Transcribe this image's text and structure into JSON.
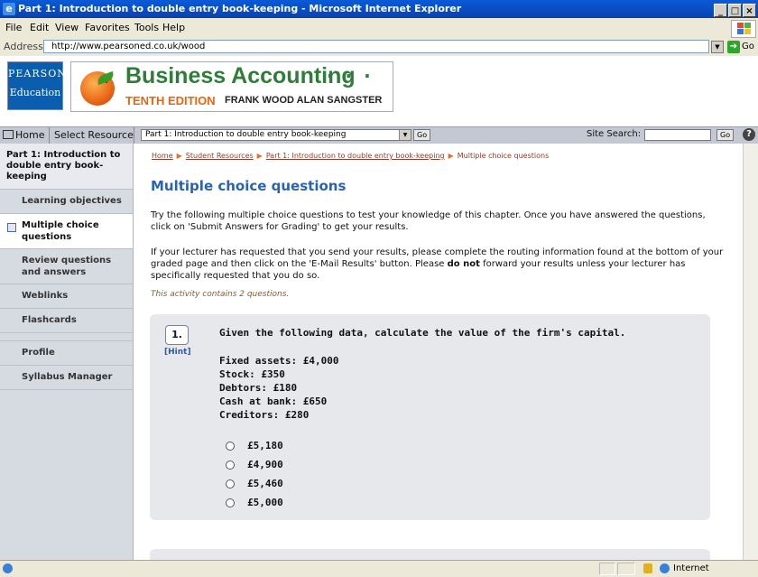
{
  "window": {
    "title": "Part 1: Introduction to double entry book-keeping - Microsoft Internet Explorer",
    "controls": [
      "_",
      "□",
      "×"
    ]
  },
  "menu": [
    "File",
    "Edit",
    "View",
    "Favorites",
    "Tools",
    "Help"
  ],
  "address": {
    "label": "Address",
    "url": "http://www.pearsoned.co.uk/wood",
    "go_label": "Go"
  },
  "banner": {
    "publisher_line1": "PEARSON",
    "publisher_line2": "Education",
    "book_title": "Business Accounting",
    "title_dots": "· · ·",
    "edition": "TENTH EDITION",
    "authors": "FRANK WOOD  ALAN SANGSTER"
  },
  "navbar": {
    "home": "Home",
    "select_resource": "Select Resource",
    "resource_value": "Part 1: Introduction to double entry book-keeping",
    "go": "Go",
    "site_search_label": "Site Search:",
    "help": "?"
  },
  "sidebar": {
    "title": "Part 1: Introduction to double entry book-keeping",
    "items": [
      {
        "label": "Learning objectives"
      },
      {
        "label": "Multiple choice questions"
      },
      {
        "label": "Review questions and answers"
      },
      {
        "label": "Weblinks"
      },
      {
        "label": "Flashcards"
      },
      {
        "label": "Profile"
      },
      {
        "label": "Syllabus Manager"
      }
    ]
  },
  "breadcrumb": {
    "items": [
      "Home",
      "Student Resources",
      "Part 1: Introduction to double entry book-keeping"
    ],
    "current": "Multiple choice questions",
    "separator": "▶"
  },
  "page": {
    "heading": "Multiple choice questions",
    "intro": "Try the following multiple choice questions to test your knowledge of this chapter. Once you have answered the questions, click on 'Submit Answers for Grading' to get your results.",
    "instructions_before_bold": "If your lecturer has requested that you send your results, please complete the routing information found at the bottom of your graded page and then click on the 'E-Mail Results' button. Please ",
    "instructions_bold": "do not",
    "instructions_after_bold": " forward your results unless your lecturer has specifically requested that you do so.",
    "activity_note": "This activity contains 2 questions."
  },
  "question": {
    "number": "1.",
    "hint": "[Hint]",
    "text": "Given the following data, calculate the value of the firm's capital.",
    "data_lines": [
      "Fixed assets: £4,000",
      "Stock: £350",
      "Debtors: £180",
      "Cash at bank: £650",
      "Creditors: £280"
    ],
    "options": [
      "£5,180",
      "£4,900",
      "£5,460",
      "£5,000"
    ]
  },
  "status": {
    "zone": "Internet"
  },
  "colors": {
    "titlebar": "#0a5ad8",
    "heading": "#2a62b5",
    "brand_green": "#2f7d38",
    "edition_orange": "#e5660f",
    "pearson_blue": "#0b5dad"
  }
}
